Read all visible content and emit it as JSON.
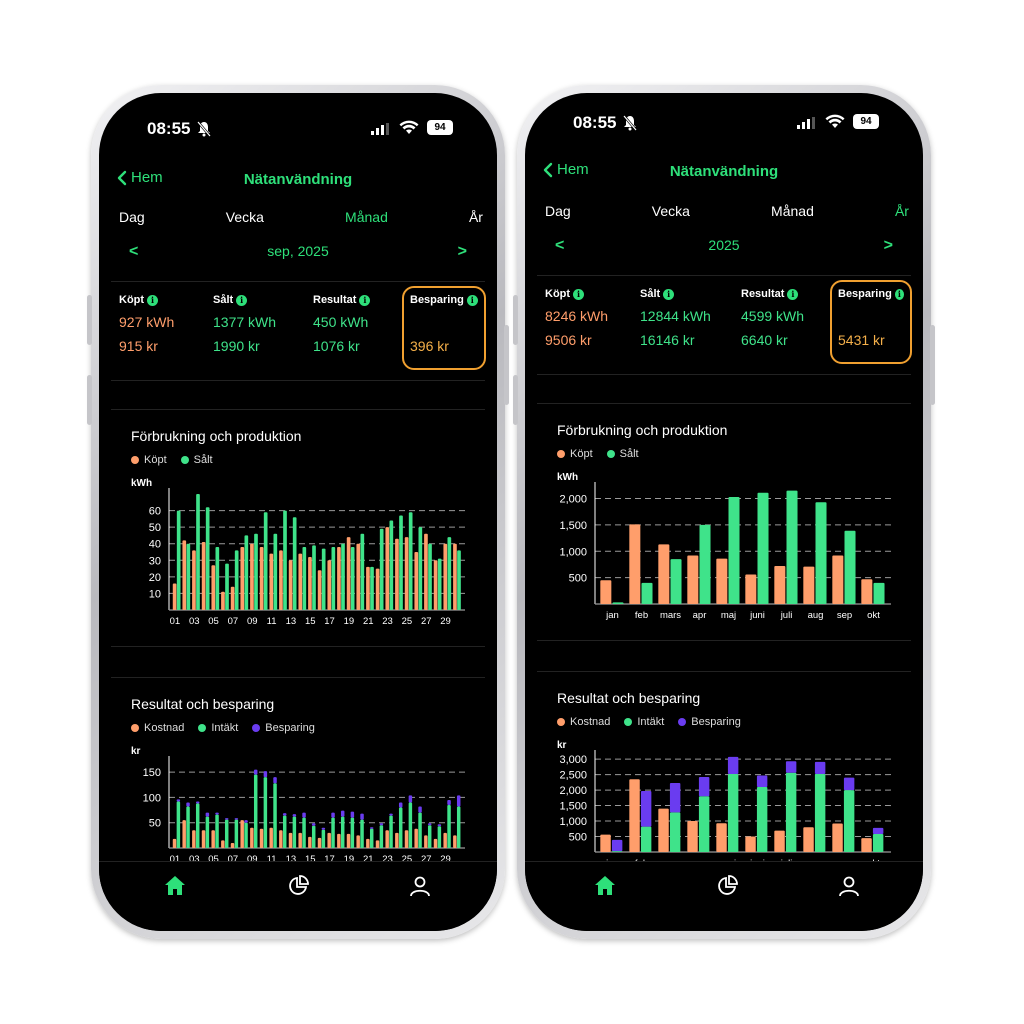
{
  "colors": {
    "accent": "#2ee07a",
    "kopt": "#ff9e6b",
    "salt": "#3fe38a",
    "besparing": "#6a3cf0",
    "highlight": "#f0a030"
  },
  "phones": [
    {
      "status": {
        "time": "08:55",
        "battery": "94"
      },
      "nav": {
        "back": "Hem",
        "title": "Nätanvändning"
      },
      "periods": [
        "Dag",
        "Vecka",
        "Månad",
        "År"
      ],
      "active_period": 2,
      "selector": {
        "prev": "<",
        "label": "sep, 2025",
        "next": ">"
      },
      "summary": [
        {
          "head": "Köpt",
          "v1": "927 kWh",
          "v2": "915 kr",
          "color": "orange"
        },
        {
          "head": "Sålt",
          "v1": "1377 kWh",
          "v2": "1990 kr",
          "color": "green"
        },
        {
          "head": "Resultat",
          "v1": "450 kWh",
          "v2": "1076 kr",
          "color": "green"
        },
        {
          "head": "Besparing",
          "v1": "",
          "v2": "396 kr",
          "color": "gold"
        }
      ],
      "chart1": {
        "title": "Förbrukning och produktion",
        "legend": [
          "Köpt",
          "Sålt"
        ]
      },
      "chart2": {
        "title": "Resultat och besparing",
        "legend": [
          "Kostnad",
          "Intäkt",
          "Besparing"
        ]
      }
    },
    {
      "status": {
        "time": "08:55",
        "battery": "94"
      },
      "nav": {
        "back": "Hem",
        "title": "Nätanvändning"
      },
      "periods": [
        "Dag",
        "Vecka",
        "Månad",
        "År"
      ],
      "active_period": 3,
      "selector": {
        "prev": "<",
        "label": "2025",
        "next": ">"
      },
      "summary": [
        {
          "head": "Köpt",
          "v1": "8246 kWh",
          "v2": "9506 kr",
          "color": "orange"
        },
        {
          "head": "Sålt",
          "v1": "12844 kWh",
          "v2": "16146 kr",
          "color": "green"
        },
        {
          "head": "Resultat",
          "v1": "4599 kWh",
          "v2": "6640 kr",
          "color": "green"
        },
        {
          "head": "Besparing",
          "v1": "",
          "v2": "5431 kr",
          "color": "gold"
        }
      ],
      "chart1": {
        "title": "Förbrukning och produktion",
        "legend": [
          "Köpt",
          "Sålt"
        ]
      },
      "chart2": {
        "title": "Resultat och besparing",
        "legend": [
          "Kostnad",
          "Intäkt",
          "Besparing"
        ]
      }
    }
  ],
  "chart_data": [
    {
      "type": "bar",
      "title": "",
      "ylabel": "kWh",
      "ylim": [
        0,
        70
      ],
      "yticks": [
        10,
        20,
        30,
        40,
        50,
        60
      ],
      "x": [
        "01",
        "02",
        "03",
        "04",
        "05",
        "06",
        "07",
        "08",
        "09",
        "10",
        "11",
        "12",
        "13",
        "14",
        "15",
        "16",
        "17",
        "18",
        "19",
        "20",
        "21",
        "22",
        "23",
        "24",
        "25",
        "26",
        "27",
        "28",
        "29",
        "30"
      ],
      "xtick_labels": [
        "01",
        "03",
        "05",
        "07",
        "09",
        "11",
        "13",
        "15",
        "17",
        "19",
        "21",
        "23",
        "25",
        "27",
        "29"
      ],
      "series": [
        {
          "name": "Köpt",
          "values": [
            16,
            42,
            36,
            41,
            27,
            11,
            14,
            38,
            40,
            38,
            34,
            36,
            30,
            34,
            32,
            24,
            30,
            38,
            44,
            40,
            26,
            25,
            50,
            43,
            44,
            35,
            46,
            30,
            40,
            40
          ]
        },
        {
          "name": "Sålt",
          "values": [
            60,
            40,
            70,
            62,
            38,
            28,
            36,
            45,
            46,
            59,
            46,
            60,
            56,
            38,
            39,
            37,
            38,
            40,
            38,
            46,
            26,
            49,
            54,
            57,
            59,
            50,
            40,
            31,
            44,
            36
          ]
        }
      ]
    },
    {
      "type": "bar",
      "title": "",
      "ylabel": "kWh",
      "ylim": [
        0,
        2200
      ],
      "yticks": [
        500,
        1000,
        1500,
        2000
      ],
      "ytick_labels": [
        "500",
        "1,000",
        "1,500",
        "2,000"
      ],
      "categories": [
        "jan",
        "feb",
        "mars",
        "apr",
        "maj",
        "juni",
        "juli",
        "aug",
        "sep",
        "okt"
      ],
      "series": [
        {
          "name": "Köpt",
          "values": [
            450,
            1510,
            1130,
            920,
            860,
            560,
            720,
            710,
            920,
            470
          ]
        },
        {
          "name": "Sålt",
          "values": [
            30,
            400,
            850,
            1500,
            2030,
            2110,
            2150,
            1930,
            1390,
            400
          ]
        }
      ]
    },
    {
      "type": "bar",
      "title": "",
      "ylabel": "kr",
      "ylim": [
        0,
        170
      ],
      "yticks": [
        50,
        100,
        150
      ],
      "x": [
        "01",
        "02",
        "03",
        "04",
        "05",
        "06",
        "07",
        "08",
        "09",
        "10",
        "11",
        "12",
        "13",
        "14",
        "15",
        "16",
        "17",
        "18",
        "19",
        "20",
        "21",
        "22",
        "23",
        "24",
        "25",
        "26",
        "27",
        "28",
        "29",
        "30"
      ],
      "xtick_labels": [
        "01",
        "03",
        "05",
        "07",
        "09",
        "11",
        "13",
        "15",
        "17",
        "19",
        "21",
        "23",
        "25",
        "27",
        "29"
      ],
      "series": [
        {
          "name": "Kostnad",
          "values": [
            18,
            55,
            35,
            35,
            35,
            15,
            10,
            55,
            40,
            38,
            40,
            35,
            30,
            30,
            22,
            20,
            30,
            28,
            28,
            25,
            18,
            15,
            35,
            30,
            35,
            38,
            25,
            18,
            30,
            25
          ]
        },
        {
          "name": "Intäkt",
          "values": [
            92,
            82,
            88,
            62,
            66,
            56,
            56,
            50,
            145,
            140,
            128,
            64,
            62,
            60,
            44,
            36,
            60,
            62,
            60,
            56,
            38,
            45,
            64,
            80,
            90,
            70,
            45,
            43,
            85,
            82
          ]
        },
        {
          "name": "Besparing",
          "values": [
            4,
            8,
            4,
            8,
            4,
            3,
            3,
            5,
            10,
            12,
            12,
            5,
            5,
            10,
            5,
            4,
            10,
            12,
            12,
            12,
            3,
            4,
            4,
            10,
            14,
            12,
            4,
            4,
            10,
            22
          ]
        }
      ]
    },
    {
      "type": "bar",
      "title": "",
      "ylabel": "kr",
      "ylim": [
        0,
        3100
      ],
      "yticks": [
        500,
        1000,
        1500,
        2000,
        2500,
        3000
      ],
      "ytick_labels": [
        "500",
        "1,000",
        "1,500",
        "2,000",
        "2,500",
        "3,000"
      ],
      "categories": [
        "jan",
        "feb",
        "mars",
        "apr",
        "maj",
        "juni",
        "juli",
        "aug",
        "sep",
        "okt"
      ],
      "series": [
        {
          "name": "Kostnad",
          "values": [
            560,
            2350,
            1400,
            1000,
            930,
            500,
            690,
            800,
            920,
            450
          ]
        },
        {
          "name": "Intäkt",
          "values": [
            30,
            820,
            1280,
            1800,
            2520,
            2100,
            2560,
            2520,
            2000,
            580
          ]
        },
        {
          "name": "Besparing",
          "values": [
            360,
            1150,
            950,
            620,
            550,
            370,
            370,
            390,
            400,
            200
          ]
        }
      ]
    }
  ]
}
